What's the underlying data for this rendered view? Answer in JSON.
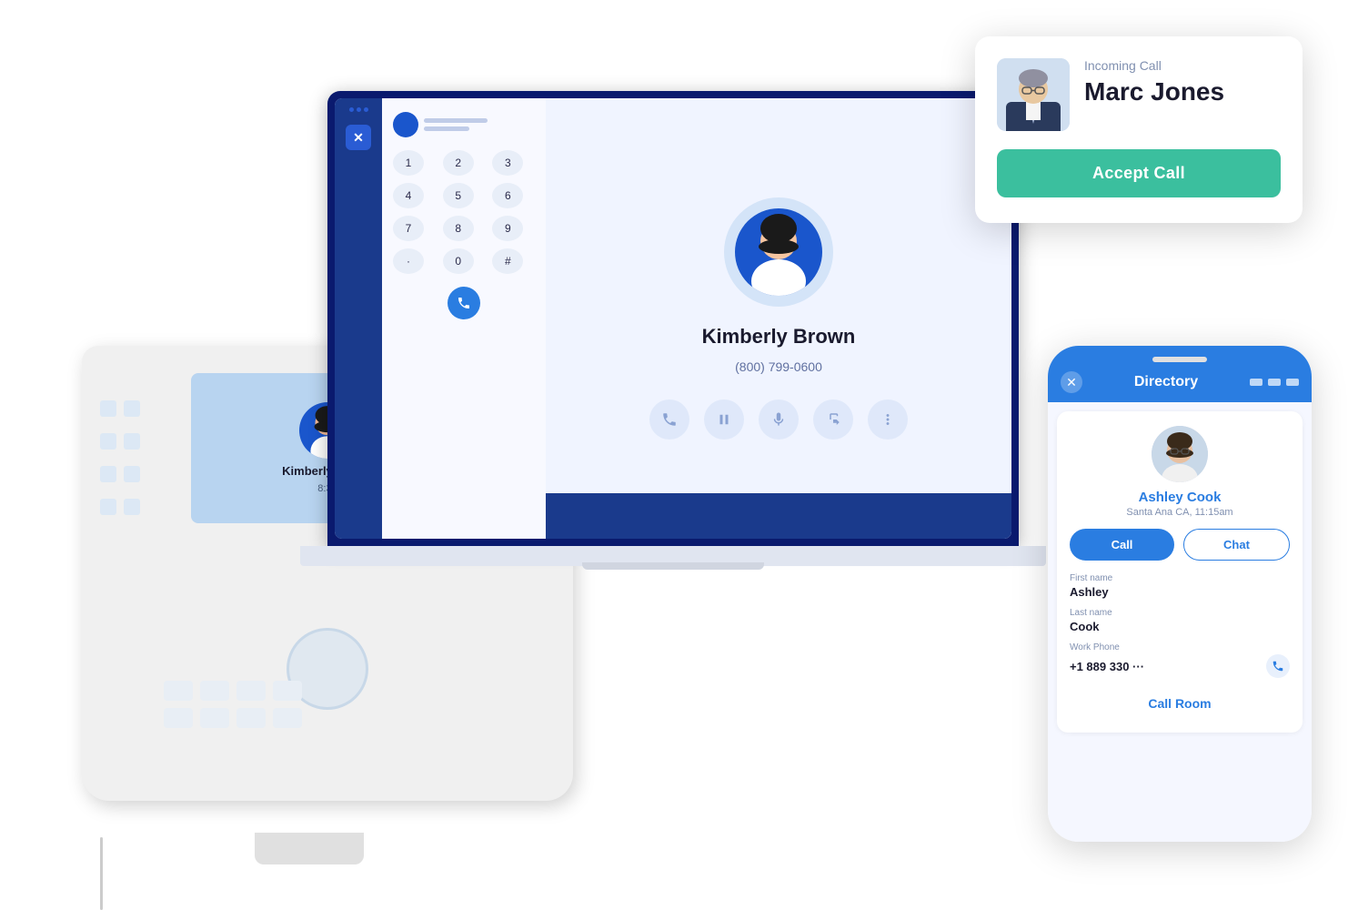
{
  "scene": {
    "bg": "#fff"
  },
  "incomingCall": {
    "label": "Incoming Call",
    "name": "Marc Jones",
    "acceptLabel": "Accept Call"
  },
  "deskPhone": {
    "contactName": "Kimberly Brown",
    "sub": "8:34"
  },
  "laptop": {
    "app": {
      "sidebarIcon": "✕",
      "dialKeys": [
        "1",
        "2",
        "3",
        "4",
        "5",
        "6",
        "7",
        "8",
        "9",
        "·",
        "0",
        "#"
      ],
      "contact": {
        "name": "Kimberly Brown",
        "phone": "(800) 799-0600"
      }
    }
  },
  "mobilePhone": {
    "headerTitle": "Directory",
    "contact": {
      "name": "Ashley Cook",
      "location": "Santa Ana CA, 11:15am",
      "firstName": "Ashley",
      "lastName": "Cook",
      "workPhoneLabel": "Work Phone",
      "workPhone": "+1 889 330 ···",
      "callLabel": "Call",
      "chatLabel": "Chat",
      "callRoomLabel": "Call Room",
      "firstNameLabel": "First name",
      "lastNameLabel": "Last name"
    }
  }
}
